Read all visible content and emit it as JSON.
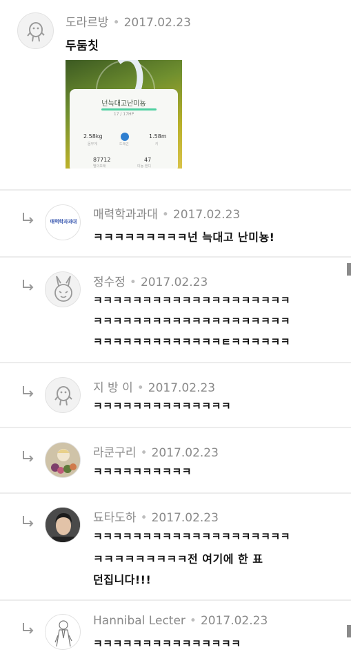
{
  "comments": [
    {
      "author": "도라르방",
      "date": "2017.02.23",
      "lines": [
        "두둠칫"
      ],
      "avatar": "ghost-icon",
      "reply": false
    },
    {
      "author": "매력학과과대",
      "date": "2017.02.23",
      "lines": [
        "ㅋㅋㅋㅋㅋㅋㅋㅋㅋ넌 늑대고 난미뇽!"
      ],
      "avatar": "text-logo",
      "avatar_text": "매력학과과대",
      "reply": true
    },
    {
      "author": "정수정",
      "date": "2017.02.23",
      "lines": [
        "ㅋㅋㅋㅋㅋㅋㅋㅋㅋㅋㅋㅋㅋㅋㅋㅋㅋㅋㅋㅋ",
        "ㅋㅋㅋㅋㅋㅋㅋㅋㅋㅋㅋㅋㅋㅋㅋㅋㅋㅋㅋㅋ",
        "ㅋㅋㅋㅋㅋㅋㅋㅋㅋㅋㅋㅋㅋㅌㅋㅋㅋㅋㅋㅋ"
      ],
      "avatar": "rabbit-icon",
      "reply": true
    },
    {
      "author": "지 방 이",
      "date": "2017.02.23",
      "lines": [
        "ㅋㅋㅋㅋㅋㅋㅋㅋㅋㅋㅋㅋㅋㅋ"
      ],
      "avatar": "ghost-icon",
      "reply": true
    },
    {
      "author": "라쿤구리",
      "date": "2017.02.23",
      "lines": [
        "ㅋㅋㅋㅋㅋㅋㅋㅋㅋㅋ"
      ],
      "avatar": "photo-bouquet",
      "reply": true
    },
    {
      "author": "됴타도하",
      "date": "2017.02.23",
      "lines": [
        "ㅋㅋㅋㅋㅋㅋㅋㅋㅋㅋㅋㅋㅋㅋㅋㅋㅋㅋㅋㅋ",
        "ㅋㅋㅋㅋㅋㅋㅋㅋㅋ전 여기에 한 표",
        "던집니다!!!"
      ],
      "avatar": "photo-person",
      "reply": true
    },
    {
      "author": "Hannibal Lecter",
      "date": "2017.02.23",
      "lines": [
        "ㅋㅋㅋㅋㅋㅋㅋㅋㅋㅋㅋㅋㅋㅋㅋ"
      ],
      "avatar": "sketch-figure",
      "reply": true
    }
  ],
  "pokemon_card": {
    "name": "넌늑대고난미뇽",
    "hp": "17 / 17HP",
    "weight": "2.58kg",
    "weight_label": "몸무게",
    "type_label": "드래곤",
    "height": "1.58m",
    "height_label": "키",
    "stardust": "87712",
    "stardust_label": "별의모래",
    "candy": "47",
    "candy_label": "미뇽 캔디"
  },
  "colors": {
    "meta": "#8a8a8a",
    "divider": "#ececec",
    "hp_bar": "#4fd0a0"
  }
}
